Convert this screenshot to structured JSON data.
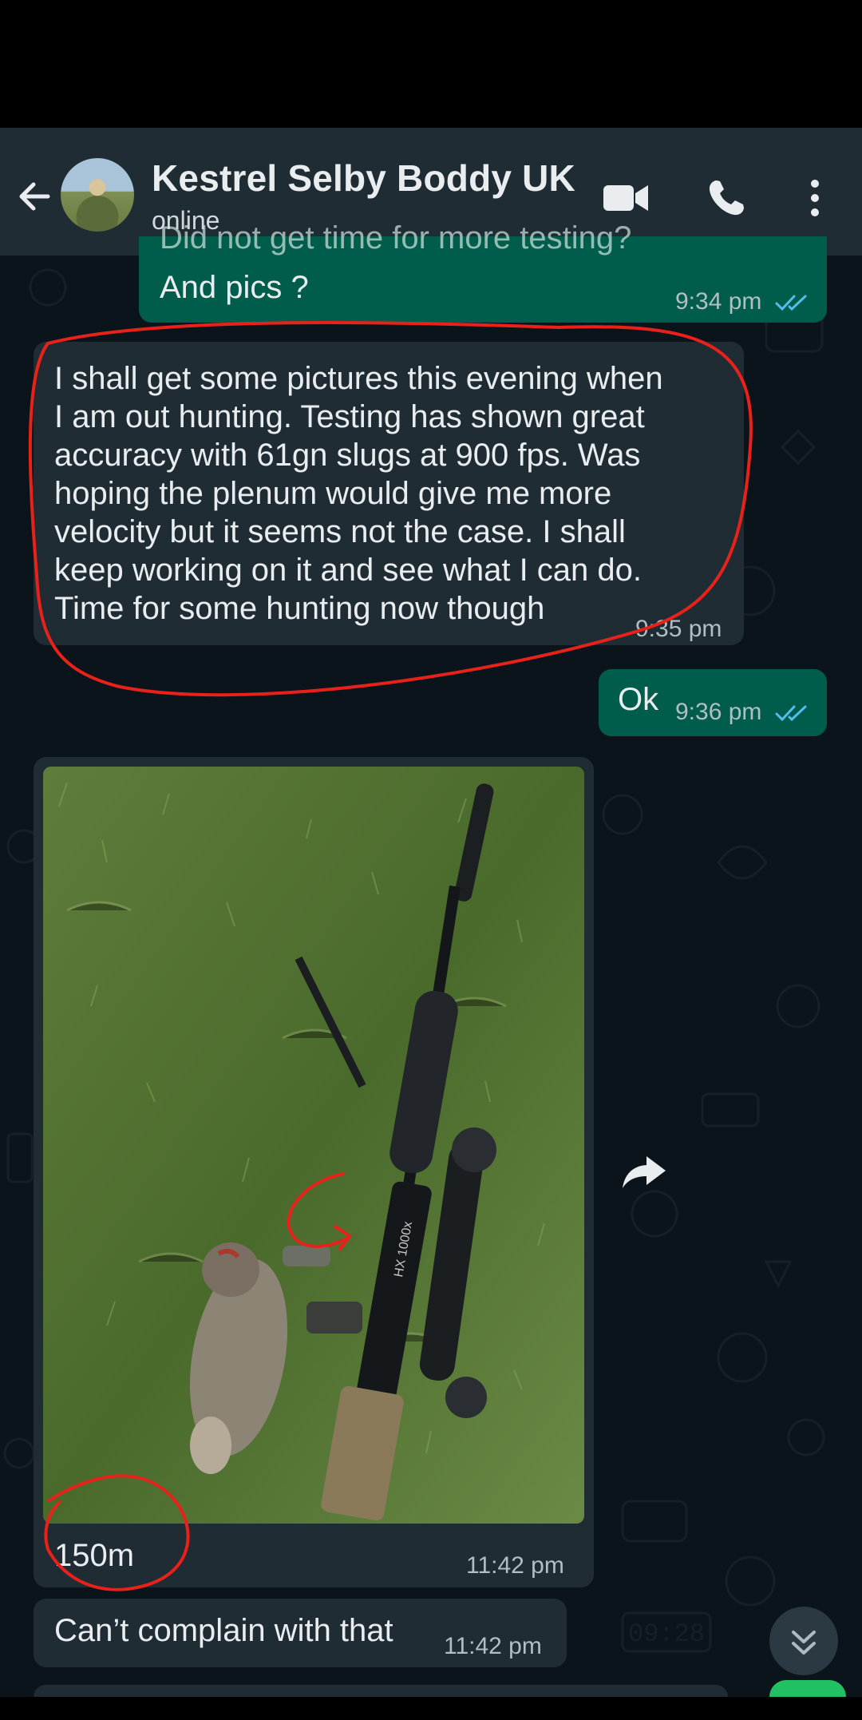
{
  "header": {
    "contact_name": "Kestrel Selby Boddy UK",
    "status": "online"
  },
  "messages": [
    {
      "direction": "outgoing",
      "partial_text": "Did not get time for more testing?",
      "text": "And pics ?",
      "time": "9:34 pm",
      "read": true
    },
    {
      "direction": "incoming",
      "lines": [
        "I shall get some pictures this evening when",
        "I am out hunting. Testing has shown great",
        "accuracy with 61gn slugs at 900 fps. Was",
        "hoping the plenum would give me more",
        "velocity but it seems not the case. I shall",
        "keep working on it and see what I can do.",
        "Time for some hunting now though"
      ],
      "time": "9:35 pm"
    },
    {
      "direction": "outgoing",
      "text": "Ok",
      "time": "9:36 pm",
      "read": true
    },
    {
      "direction": "incoming",
      "type": "image",
      "caption": "150m",
      "time": "11:42 pm",
      "photo_text": "HX 1000x"
    },
    {
      "direction": "incoming",
      "text": "Can’t complain with that",
      "time": "11:42 pm"
    }
  ],
  "wallpaper_doodle": "09:28",
  "colors": {
    "header": "#1f2c33",
    "chat_background": "#0b141a",
    "outgoing_bubble": "#005c4b",
    "incoming_bubble": "#1f2c33",
    "read_ticks": "#53bdeb",
    "annotation": "#e8221b"
  }
}
